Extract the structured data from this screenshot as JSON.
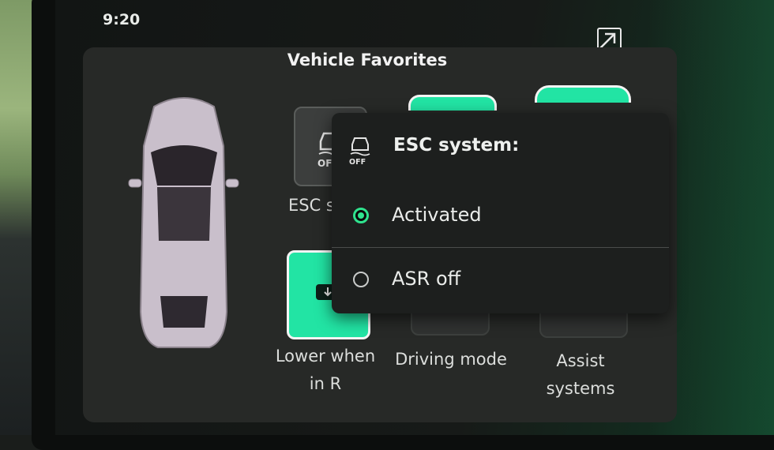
{
  "status_bar": {
    "time": "9:20"
  },
  "panel": {
    "title": "Vehicle Favorites",
    "tiles": [
      {
        "label": "ESC sy",
        "icon": "esc-off-icon"
      },
      {
        "label_line1": "Lower when",
        "label_line2": "in R",
        "icon": "lower-mirror-icon"
      },
      {
        "label": "Driving mode"
      },
      {
        "label_line1": "Assist",
        "label_line2": "systems"
      }
    ]
  },
  "popup": {
    "title": "ESC system:",
    "icon_text": "OFF",
    "options": [
      {
        "label": "Activated",
        "selected": true
      },
      {
        "label": "ASR off",
        "selected": false
      }
    ]
  },
  "colors": {
    "accent_green": "#22e4a4",
    "radio_active": "#2fe38e",
    "panel_bg": "#272927"
  }
}
